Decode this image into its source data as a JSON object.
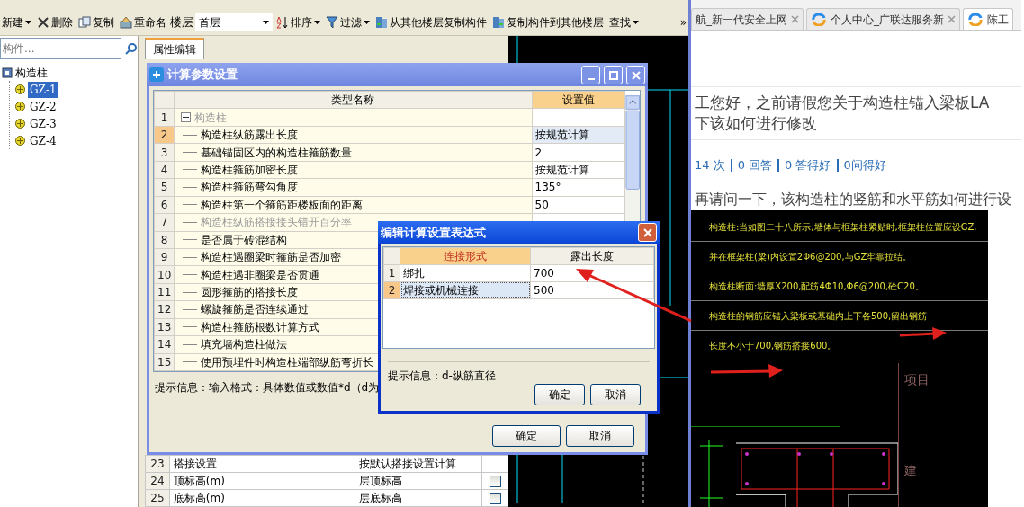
{
  "toolbar": [
    {
      "kind": "button",
      "label": "新建",
      "dropdown": true
    },
    {
      "kind": "button",
      "label": "删除",
      "dropdown": false
    },
    {
      "kind": "button",
      "label": "复制",
      "dropdown": false
    },
    {
      "kind": "button",
      "label": "重命名",
      "dropdown": false
    },
    {
      "kind": "label",
      "label": "楼层"
    },
    {
      "kind": "select",
      "value": "首层"
    },
    {
      "kind": "button",
      "label": "排序",
      "dropdown": true
    },
    {
      "kind": "button",
      "label": "过滤",
      "dropdown": true
    },
    {
      "kind": "button",
      "label": "从其他楼层复制构件",
      "dropdown": false
    },
    {
      "kind": "button",
      "label": "复制构件到其他楼层",
      "dropdown": false
    },
    {
      "kind": "button",
      "label": "查找",
      "dropdown": true
    },
    {
      "kind": "overflow",
      "label": "»"
    }
  ],
  "search": {
    "placeholder": "构件..."
  },
  "tree": {
    "label": "构造柱",
    "children": [
      {
        "label": "GZ-1",
        "selected": true
      },
      {
        "label": "GZ-2",
        "selected": false
      },
      {
        "label": "GZ-3",
        "selected": false
      },
      {
        "label": "GZ-4",
        "selected": false
      }
    ]
  },
  "property_panel": {
    "tab": "属性编辑",
    "rows": [
      {
        "index": "23",
        "name": "搭接设置",
        "value": "按默认搭接设置计算",
        "kind": "text"
      },
      {
        "index": "24",
        "name": "顶标高(m)",
        "value": "层顶标高",
        "kind": "checkbox",
        "checked": false
      },
      {
        "index": "25",
        "name": "底标高(m)",
        "value": "层底标高",
        "kind": "checkbox",
        "checked": false
      }
    ]
  },
  "calc_dialog": {
    "title": "计算参数设置",
    "columns": [
      "类型名称",
      "设置值"
    ],
    "rows": [
      {
        "index": "1",
        "name": "构造柱",
        "kind": "group",
        "expanded": true,
        "selected": false,
        "disabled": true
      },
      {
        "index": "2",
        "name": "构造柱纵筋露出长度",
        "value": "按规范计算",
        "kind": "item",
        "selected": true,
        "disabled": false
      },
      {
        "index": "3",
        "name": "基础锚固区内的构造柱箍筋数量",
        "value": "2",
        "kind": "item",
        "selected": false,
        "disabled": false
      },
      {
        "index": "4",
        "name": "构造柱箍筋加密长度",
        "value": "按规范计算",
        "kind": "item",
        "selected": false,
        "disabled": false
      },
      {
        "index": "5",
        "name": "构造柱箍筋弯勾角度",
        "value": "135°",
        "kind": "item",
        "selected": false,
        "disabled": false
      },
      {
        "index": "6",
        "name": "构造柱第一个箍筋距楼板面的距离",
        "value": "50",
        "kind": "item",
        "selected": false,
        "disabled": false
      },
      {
        "index": "7",
        "name": "构造柱纵筋搭接接头错开百分率",
        "kind": "item",
        "selected": false,
        "disabled": true
      },
      {
        "index": "8",
        "name": "是否属于砖混结构",
        "kind": "item",
        "selected": false,
        "disabled": false
      },
      {
        "index": "9",
        "name": "构造柱遇圈梁时箍筋是否加密",
        "kind": "item",
        "selected": false,
        "disabled": false
      },
      {
        "index": "10",
        "name": "构造柱遇非圈梁是否贯通",
        "kind": "item",
        "selected": false,
        "disabled": false
      },
      {
        "index": "11",
        "name": "圆形箍筋的搭接长度",
        "kind": "item",
        "selected": false,
        "disabled": false
      },
      {
        "index": "12",
        "name": "螺旋箍筋是否连续通过",
        "kind": "item",
        "selected": false,
        "disabled": false
      },
      {
        "index": "13",
        "name": "构造柱箍筋根数计算方式",
        "kind": "item",
        "selected": false,
        "disabled": false
      },
      {
        "index": "14",
        "name": "填充墙构造柱做法",
        "kind": "item",
        "selected": false,
        "disabled": false
      },
      {
        "index": "15",
        "name": "使用预埋件时构造柱端部纵筋弯折长",
        "kind": "item",
        "selected": false,
        "disabled": false
      }
    ],
    "hint": "提示信息：输入格式：具体数值或数值*d（d为",
    "buttons": [
      "确定",
      "取消"
    ]
  },
  "expr_dialog": {
    "title": "编辑计算设置表达式",
    "columns": [
      "连接形式",
      "露出长度"
    ],
    "rows": [
      {
        "index": "1",
        "type": "绑扎",
        "length": "700",
        "selected": false
      },
      {
        "index": "2",
        "type": "焊接或机械连接",
        "length": "500",
        "selected": true
      }
    ],
    "hint": "提示信息：d-纵筋直径",
    "buttons": [
      "确定",
      "取消"
    ]
  },
  "browser": {
    "tabs": [
      {
        "title": "航_新一代安全上网",
        "selected": false
      },
      {
        "title": "个人中心_广联达服务新",
        "selected": false
      },
      {
        "title": "陈工",
        "selected": true
      }
    ],
    "question_title": [
      "工您好，之前请假您关于构造柱锚入梁板LA",
      "下该如何进行修改"
    ],
    "stats": [
      "14 次",
      "0 回答",
      "0 答得好",
      "0问得好"
    ],
    "question_body": "再请问一下，该构造柱的竖筋和水平筋如何进行设",
    "drawing_notes": [
      "构造柱:当如图二十八所示,墙体与框架柱紧贴时,框架柱位置应设GZ,",
      "并在框架柱(梁)内设置2Φ6@200,与GZ牢靠拉结。",
      "构造柱断面:墙厚X200,配筋4Φ10,Φ6@200,砼C20。",
      "构造柱的钢筋应锚入梁板或基础内上下各500,留出钢筋",
      "长度不小于700,钢筋搭接600。"
    ],
    "drawing_labels": [
      "项目",
      "建"
    ]
  }
}
